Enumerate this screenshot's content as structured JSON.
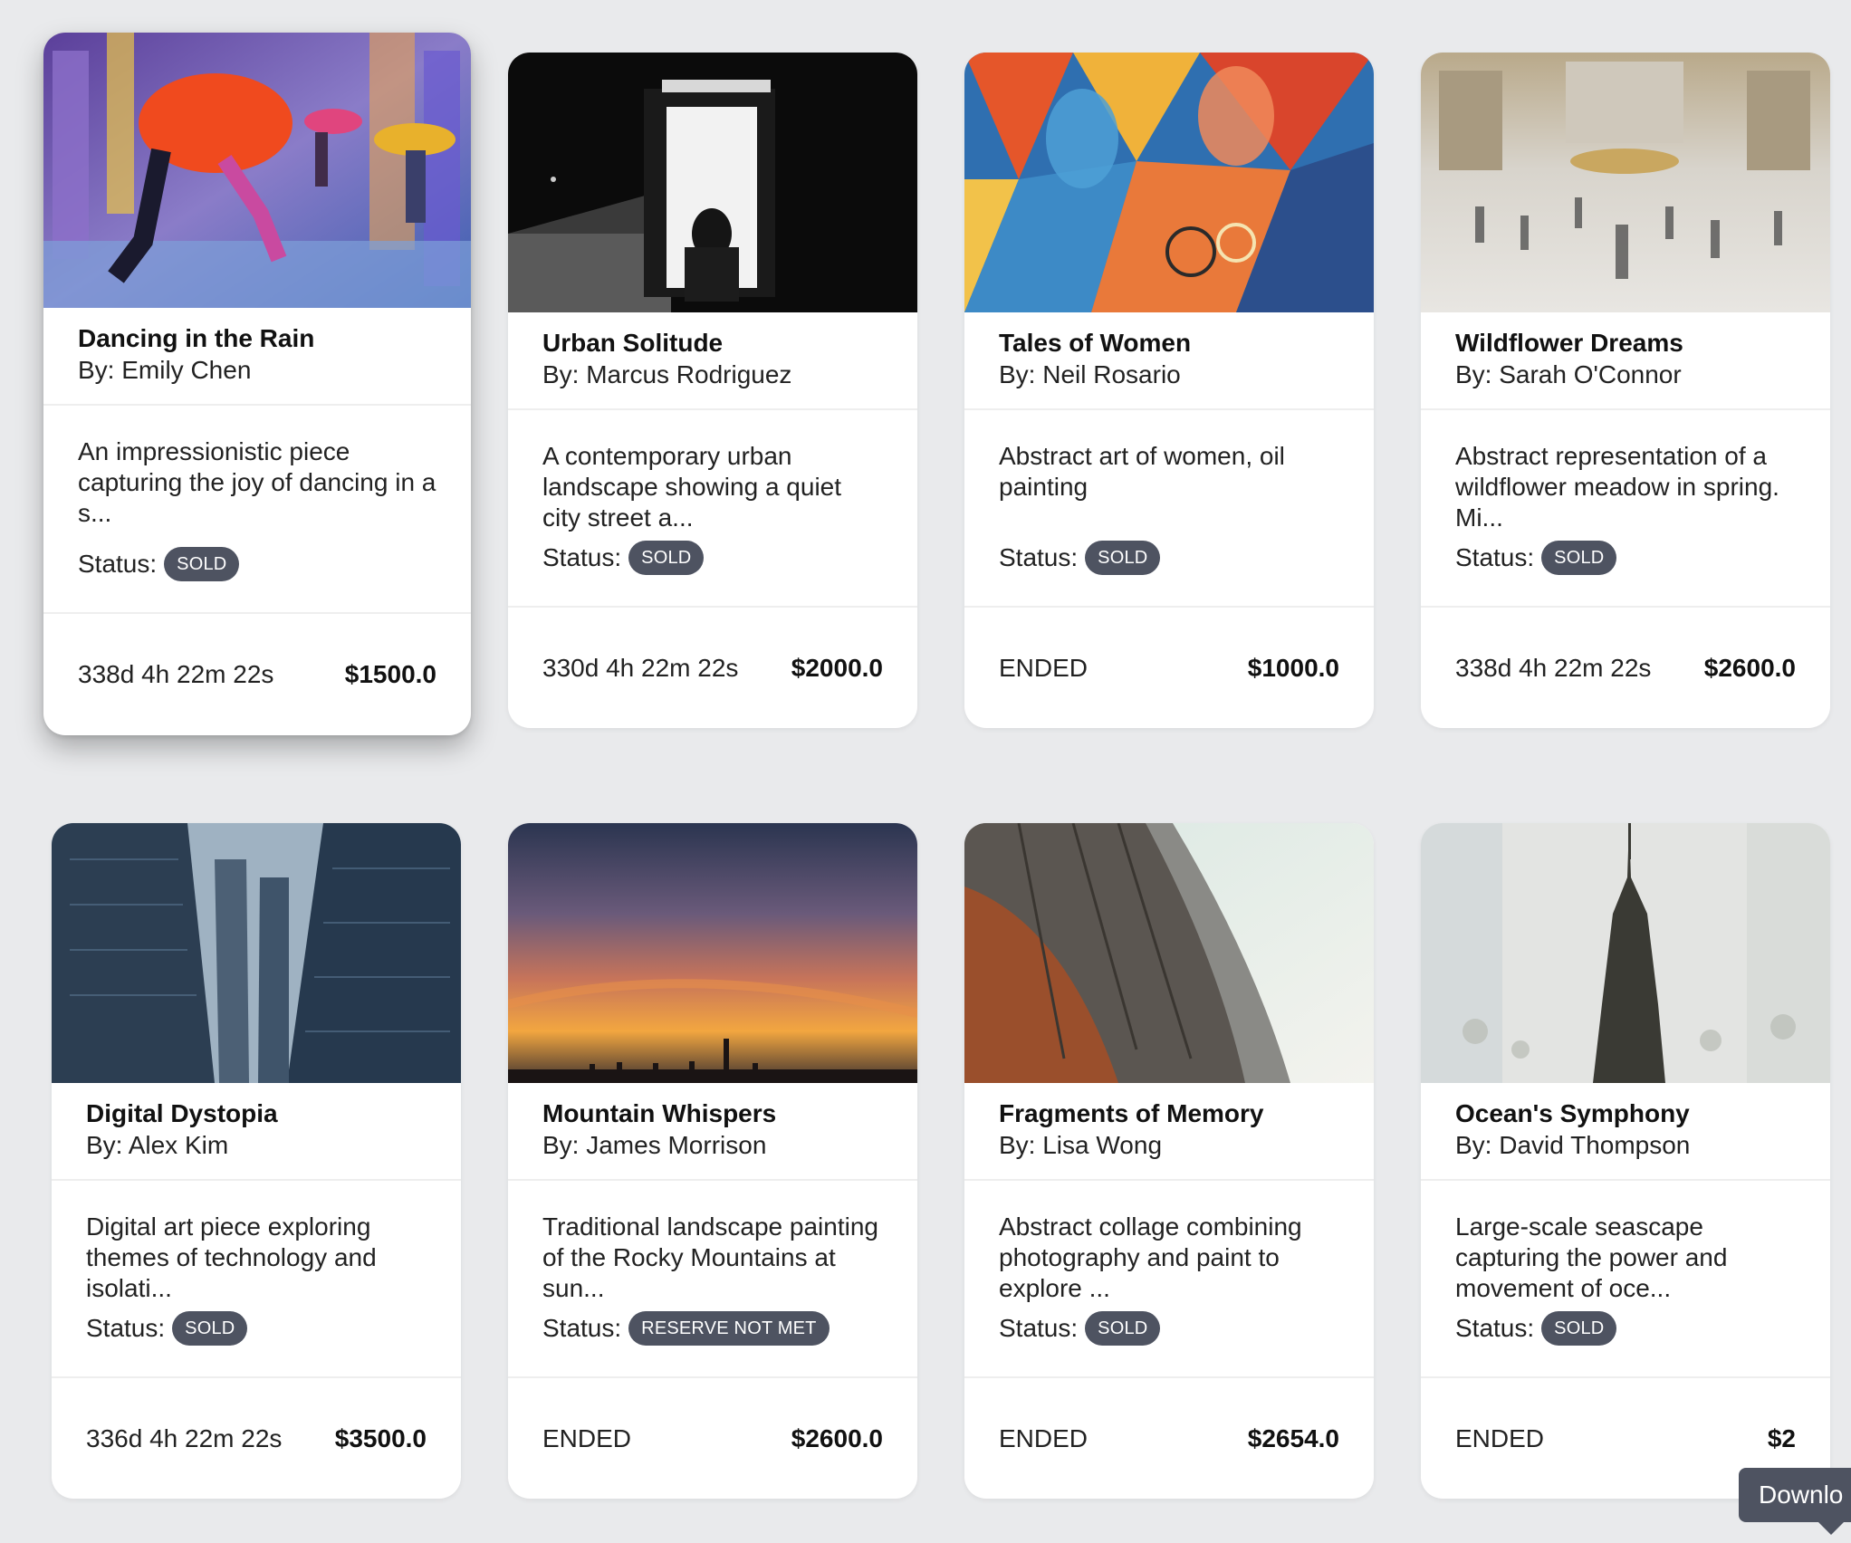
{
  "cards": [
    {
      "title": "Dancing in the Rain",
      "artist": "By: Emily Chen",
      "description": "An impressionistic piece capturing the joy of dancing in a s...",
      "status_label": "Status:",
      "status": "SOLD",
      "time": "338d 4h 22m 22s",
      "price": "$1500.0",
      "image": "impressionist-couple-under-red-umbrella-painting"
    },
    {
      "title": "Urban Solitude",
      "artist": "By: Marcus Rodriguez",
      "description": "A contemporary urban landscape showing a quiet city street a...",
      "status_label": "Status:",
      "status": "SOLD",
      "time": "330d 4h 22m 22s",
      "price": "$2000.0",
      "image": "black-and-white-bus-shelter-photo"
    },
    {
      "title": "Tales of Women",
      "artist": "By: Neil Rosario",
      "description": "Abstract art of women, oil painting",
      "status_label": "Status:",
      "status": "SOLD",
      "time": "ENDED",
      "price": "$1000.0",
      "image": "colorful-abstract-faces-painting"
    },
    {
      "title": "Wildflower Dreams",
      "artist": "By: Sarah O'Connor",
      "description": "Abstract representation of a wildflower meadow in spring. Mi...",
      "status_label": "Status:",
      "status": "SOLD",
      "time": "338d 4h 22m 22s",
      "price": "$2600.0",
      "image": "busy-train-station-hall-photo"
    },
    {
      "title": "Digital Dystopia",
      "artist": "By: Alex Kim",
      "description": "Digital art piece exploring themes of technology and isolati...",
      "status_label": "Status:",
      "status": "SOLD",
      "time": "336d 4h 22m 22s",
      "price": "$3500.0",
      "image": "city-skyscrapers-street-photo"
    },
    {
      "title": "Mountain Whispers",
      "artist": "By: James Morrison",
      "description": "Traditional landscape painting of the Rocky Mountains at sun...",
      "status_label": "Status:",
      "status": "RESERVE NOT MET",
      "time": "ENDED",
      "price": "$2600.0",
      "image": "sunset-sky-over-water-photo"
    },
    {
      "title": "Fragments of Memory",
      "artist": "By: Lisa Wong",
      "description": "Abstract collage combining photography and paint to explore ...",
      "status_label": "Status:",
      "status": "SOLD",
      "time": "ENDED",
      "price": "$2654.0",
      "image": "curved-building-roof-against-sky-photo"
    },
    {
      "title": "Ocean's Symphony",
      "artist": "By: David Thompson",
      "description": "Large-scale seascape capturing the power and movement of oce...",
      "status_label": "Status:",
      "status": "SOLD",
      "time": "ENDED",
      "price": "$2",
      "image": "double-exposure-empire-state-building-photo"
    }
  ],
  "tooltip": {
    "label": "Downlo"
  },
  "colors": {
    "page_background": "#e9eaec",
    "card_background": "#ffffff",
    "badge_background": "#4e5361",
    "badge_text": "#ffffff"
  }
}
